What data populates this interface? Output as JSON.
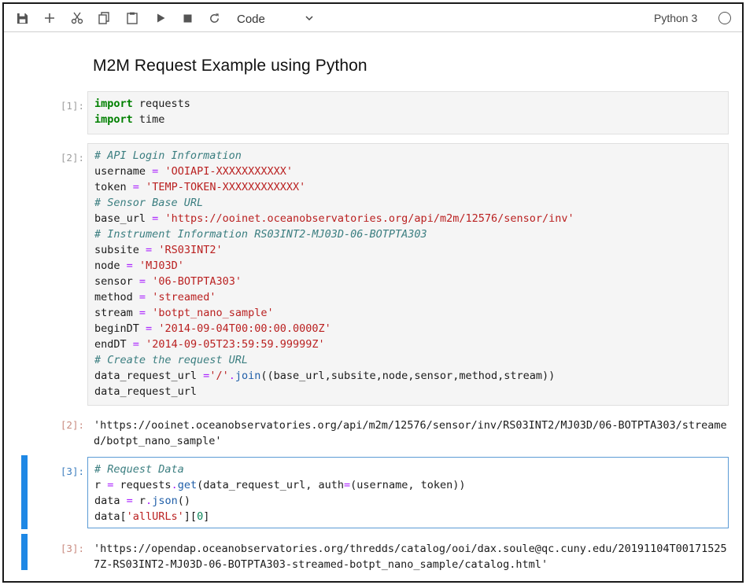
{
  "toolbar": {
    "cell_type": "Code",
    "kernel_name": "Python 3",
    "icons": [
      "save-icon",
      "add-cell-icon",
      "cut-icon",
      "copy-icon",
      "paste-icon",
      "run-icon",
      "stop-icon",
      "restart-icon",
      "chevron-down-icon",
      "kernel-status-icon"
    ]
  },
  "notebook": {
    "heading": "M2M Request Example using Python",
    "cells": [
      {
        "prompt": "[1]:"
      },
      {
        "prompt": "[2]:"
      },
      {
        "prompt": "[2]:",
        "output": "'https://ooinet.oceanobservatories.org/api/m2m/12576/sensor/inv/RS03INT2/MJ03D/06-BOTPTA303/streamed/botpt_nano_sample'"
      },
      {
        "prompt": "[3]:"
      },
      {
        "prompt": "[3]:",
        "output": "'https://opendap.oceanobservatories.org/thredds/catalog/ooi/dax.soule@qc.cuny.edu/20191104T001715257Z-RS03INT2-MJ03D-06-BOTPTA303-streamed-botpt_nano_sample/catalog.html'"
      }
    ],
    "code": {
      "c1_l1_kw": "import",
      "c1_l1_rest": " requests",
      "c1_l2_kw": "import",
      "c1_l2_rest": " time",
      "c2_l1": "# API Login Information",
      "c2_l2_var": "username",
      "c2_l2_val": "'OOIAPI-XXXXXXXXXXX'",
      "c2_l3_var": "token",
      "c2_l3_val": "'TEMP-TOKEN-XXXXXXXXXXXX'",
      "c2_l4": "# Sensor Base URL",
      "c2_l5_var": "base_url",
      "c2_l5_val": "'https://ooinet.oceanobservatories.org/api/m2m/12576/sensor/inv'",
      "c2_l6": "# Instrument Information RS03INT2-MJ03D-06-BOTPTA303",
      "c2_l7_var": "subsite",
      "c2_l7_val": "'RS03INT2'",
      "c2_l8_var": "node",
      "c2_l8_val": "'MJ03D'",
      "c2_l9_var": "sensor",
      "c2_l9_val": "'06-BOTPTA303'",
      "c2_l10_var": "method",
      "c2_l10_val": "'streamed'",
      "c2_l11_var": "stream",
      "c2_l11_val": "'botpt_nano_sample'",
      "c2_l12_var": "beginDT",
      "c2_l12_val": "'2014-09-04T00:00:00.0000Z'",
      "c2_l13_var": "endDT",
      "c2_l13_val": "'2014-09-05T23:59:59.99999Z'",
      "c2_l14": "# Create the request URL",
      "c2_l15_var": "data_request_url ",
      "c2_l15_eq": "=",
      "c2_l15_str": "'/'",
      "c2_l15_dot": ".",
      "c2_l15_fn": "join",
      "c2_l15_args": "((base_url,subsite,node,sensor,method,stream))",
      "c2_l16": "data_request_url",
      "c3_l1": "# Request Data",
      "c3_l2_a": "r ",
      "c3_l2_eq": "=",
      "c3_l2_b": " requests",
      "c3_l2_dot": ".",
      "c3_l2_fn": "get",
      "c3_l2_c": "(data_request_url, auth",
      "c3_l2_eq2": "=",
      "c3_l2_d": "(username, token))",
      "c3_l3_a": "data ",
      "c3_l3_eq": "=",
      "c3_l3_b": " r",
      "c3_l3_dot": ".",
      "c3_l3_fn": "json",
      "c3_l3_c": "()",
      "c3_l4_a": "data[",
      "c3_l4_str": "'allURLs'",
      "c3_l4_b": "][",
      "c3_l4_num": "0",
      "c3_l4_c": "]"
    }
  }
}
